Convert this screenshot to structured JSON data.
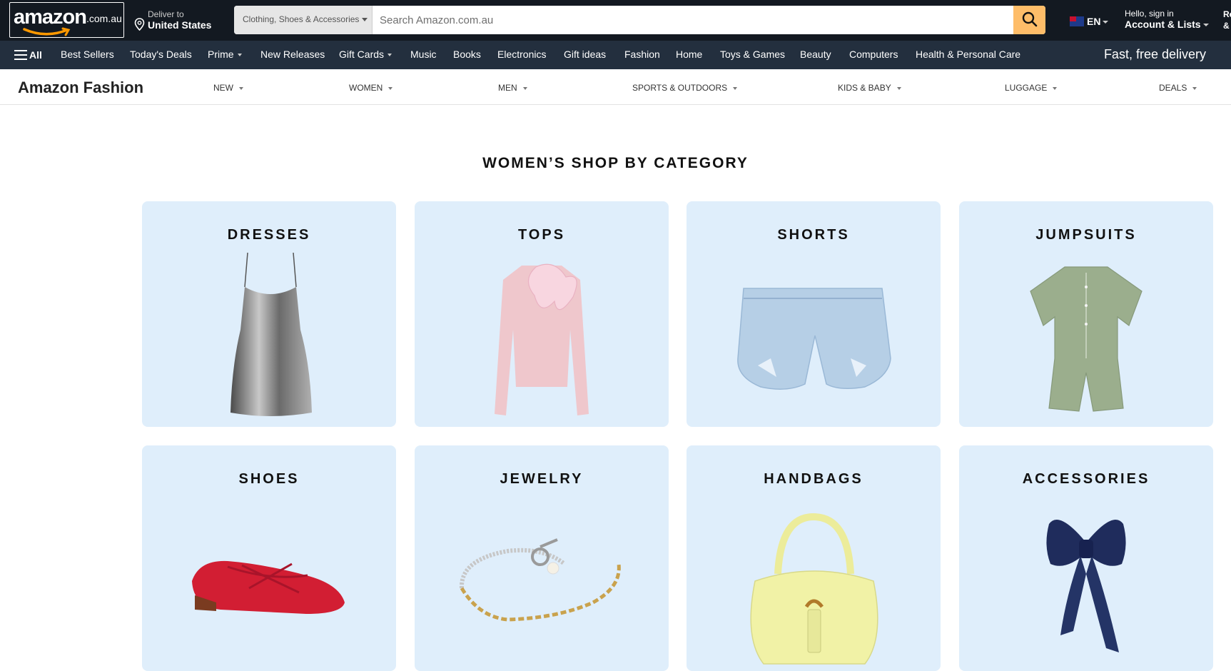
{
  "header": {
    "logo_text": "amazon",
    "logo_suffix": ".com.au",
    "deliver_line1": "Deliver to",
    "deliver_line2": "United States",
    "search_category": "Clothing, Shoes & Accessories",
    "search_placeholder": "Search Amazon.com.au",
    "language": "EN",
    "account_line1": "Hello, sign in",
    "account_line2": "Account & Lists",
    "returns_line1": "Re",
    "returns_line2": "&"
  },
  "nav": {
    "all_label": "All",
    "items": [
      {
        "label": "Best Sellers"
      },
      {
        "label": "Today's Deals"
      },
      {
        "label": "Prime"
      },
      {
        "label": "New Releases"
      },
      {
        "label": "Gift Cards"
      },
      {
        "label": "Music"
      },
      {
        "label": "Books"
      },
      {
        "label": "Electronics"
      },
      {
        "label": "Gift ideas"
      },
      {
        "label": "Fashion"
      },
      {
        "label": "Home"
      },
      {
        "label": "Toys & Games"
      },
      {
        "label": "Beauty"
      },
      {
        "label": "Computers"
      },
      {
        "label": "Health & Personal Care"
      }
    ],
    "promo": "Fast, free delivery"
  },
  "subnav": {
    "brand": "Amazon Fashion",
    "items": [
      {
        "label": "NEW"
      },
      {
        "label": "WOMEN"
      },
      {
        "label": "MEN"
      },
      {
        "label": "SPORTS & OUTDOORS"
      },
      {
        "label": "KIDS & BABY"
      },
      {
        "label": "LUGGAGE"
      },
      {
        "label": "DEALS"
      }
    ]
  },
  "main": {
    "section_title": "WOMEN’S SHOP BY CATEGORY",
    "categories": [
      {
        "label": "DRESSES",
        "icon": "dress-image"
      },
      {
        "label": "TOPS",
        "icon": "top-image"
      },
      {
        "label": "SHORTS",
        "icon": "shorts-image"
      },
      {
        "label": "JUMPSUITS",
        "icon": "jumpsuit-image"
      },
      {
        "label": "SHOES",
        "icon": "shoe-image"
      },
      {
        "label": "JEWELRY",
        "icon": "bracelet-image"
      },
      {
        "label": "HANDBAGS",
        "icon": "handbag-image"
      },
      {
        "label": "ACCESSORIES",
        "icon": "bow-image"
      }
    ]
  },
  "colors": {
    "topbar": "#131921",
    "navbar": "#232f3e",
    "search_button": "#febd69",
    "card_background": "#dfeefb"
  }
}
